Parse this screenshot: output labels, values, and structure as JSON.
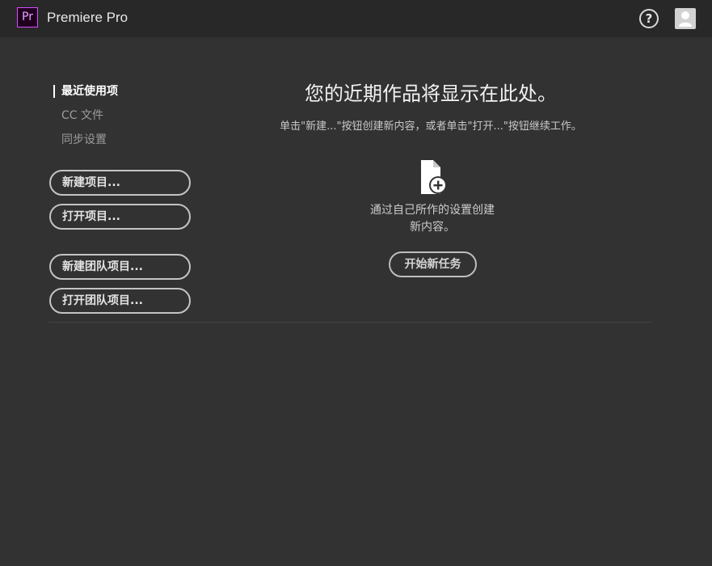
{
  "app": {
    "logo_text": "Pr",
    "title": "Premiere Pro"
  },
  "header": {
    "help_icon": "?",
    "avatar_icon": "user-icon"
  },
  "nav": {
    "items": [
      {
        "label": "最近使用项",
        "active": true
      },
      {
        "label": "CC 文件",
        "active": false
      },
      {
        "label": "同步设置",
        "active": false
      }
    ]
  },
  "actions": {
    "new_project": "新建项目...",
    "open_project": "打开项目...",
    "new_team_project": "新建团队项目...",
    "open_team_project": "打开团队项目..."
  },
  "main": {
    "title": "您的近期作品将显示在此处。",
    "subtitle": "单击\"新建...\"按钮创建新内容，或者单击\"打开...\"按钮继续工作。",
    "card_icon": "new-file-plus-icon",
    "card_desc_line1": "通过自己所作的设置创建",
    "card_desc_line2": "新内容。",
    "start_button": "开始新任务"
  },
  "colors": {
    "background": "#323232",
    "titlebar": "#282828",
    "brand_accent": "#d64cff"
  }
}
